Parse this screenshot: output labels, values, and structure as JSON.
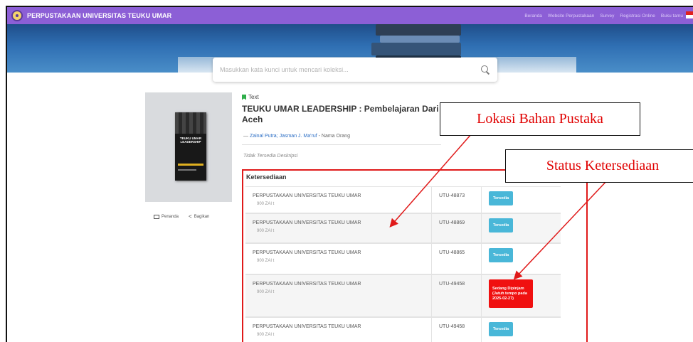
{
  "navbar": {
    "brand": "PERPUSTAKAAN UNIVERSITAS TEUKU UMAR",
    "links": [
      "Beranda",
      "Website Perpustakaan",
      "Survey",
      "Registrasi Online",
      "Buku tamu"
    ]
  },
  "search": {
    "placeholder": "Masukkan kata kunci untuk mencari koleksi..."
  },
  "book": {
    "type": "Text",
    "title": "TEUKU UMAR LEADERSHIP : Pembelajaran Dari Aceh",
    "authors_prefix": "—",
    "authors": "Zainal Putra; Jasman J. Ma'ruf",
    "authors_suffix": "- Nama Orang",
    "description": "Tidak Tersedia Deskripsi",
    "cover_text": "TEUKU UMAR LEADERSHIP"
  },
  "actions": {
    "bookmark": "Penanda",
    "share": "Bagikan"
  },
  "availability": {
    "title": "Ketersediaan",
    "rows": [
      {
        "location": "PERPUSTAKAAN UNIVERSITAS TEUKU UMAR",
        "call_no": "900 ZAI t",
        "code": "UTU-48873",
        "status": "Tersedia",
        "status_lines": []
      },
      {
        "location": "PERPUSTAKAAN UNIVERSITAS TEUKU UMAR",
        "call_no": "900 ZAI t",
        "code": "UTU-48869",
        "status": "Tersedia",
        "status_lines": []
      },
      {
        "location": "PERPUSTAKAAN UNIVERSITAS TEUKU UMAR",
        "call_no": "900 ZAI t",
        "code": "UTU-48865",
        "status": "Tersedia",
        "status_lines": []
      },
      {
        "location": "PERPUSTAKAAN UNIVERSITAS TEUKU UMAR",
        "call_no": "900 ZAI t",
        "code": "UTU-49458",
        "status": "Sedang Dipinjam",
        "status_lines": [
          "Sedang Dipinjam",
          "(Jatuh tempo pada",
          "2025-02-27)"
        ]
      },
      {
        "location": "PERPUSTAKAAN UNIVERSITAS TEUKU UMAR",
        "call_no": "900 ZAI t",
        "code": "UTU-49458",
        "status": "Tersedia",
        "status_lines": []
      }
    ]
  },
  "annotations": {
    "location_label": "Lokasi Bahan Pustaka",
    "status_label": "Status Ketersediaan"
  },
  "colors": {
    "navbar": "#8c5fd6",
    "available_badge": "#49b7d8",
    "borrowed_badge": "#f01010",
    "annotation_red": "#e00000"
  }
}
